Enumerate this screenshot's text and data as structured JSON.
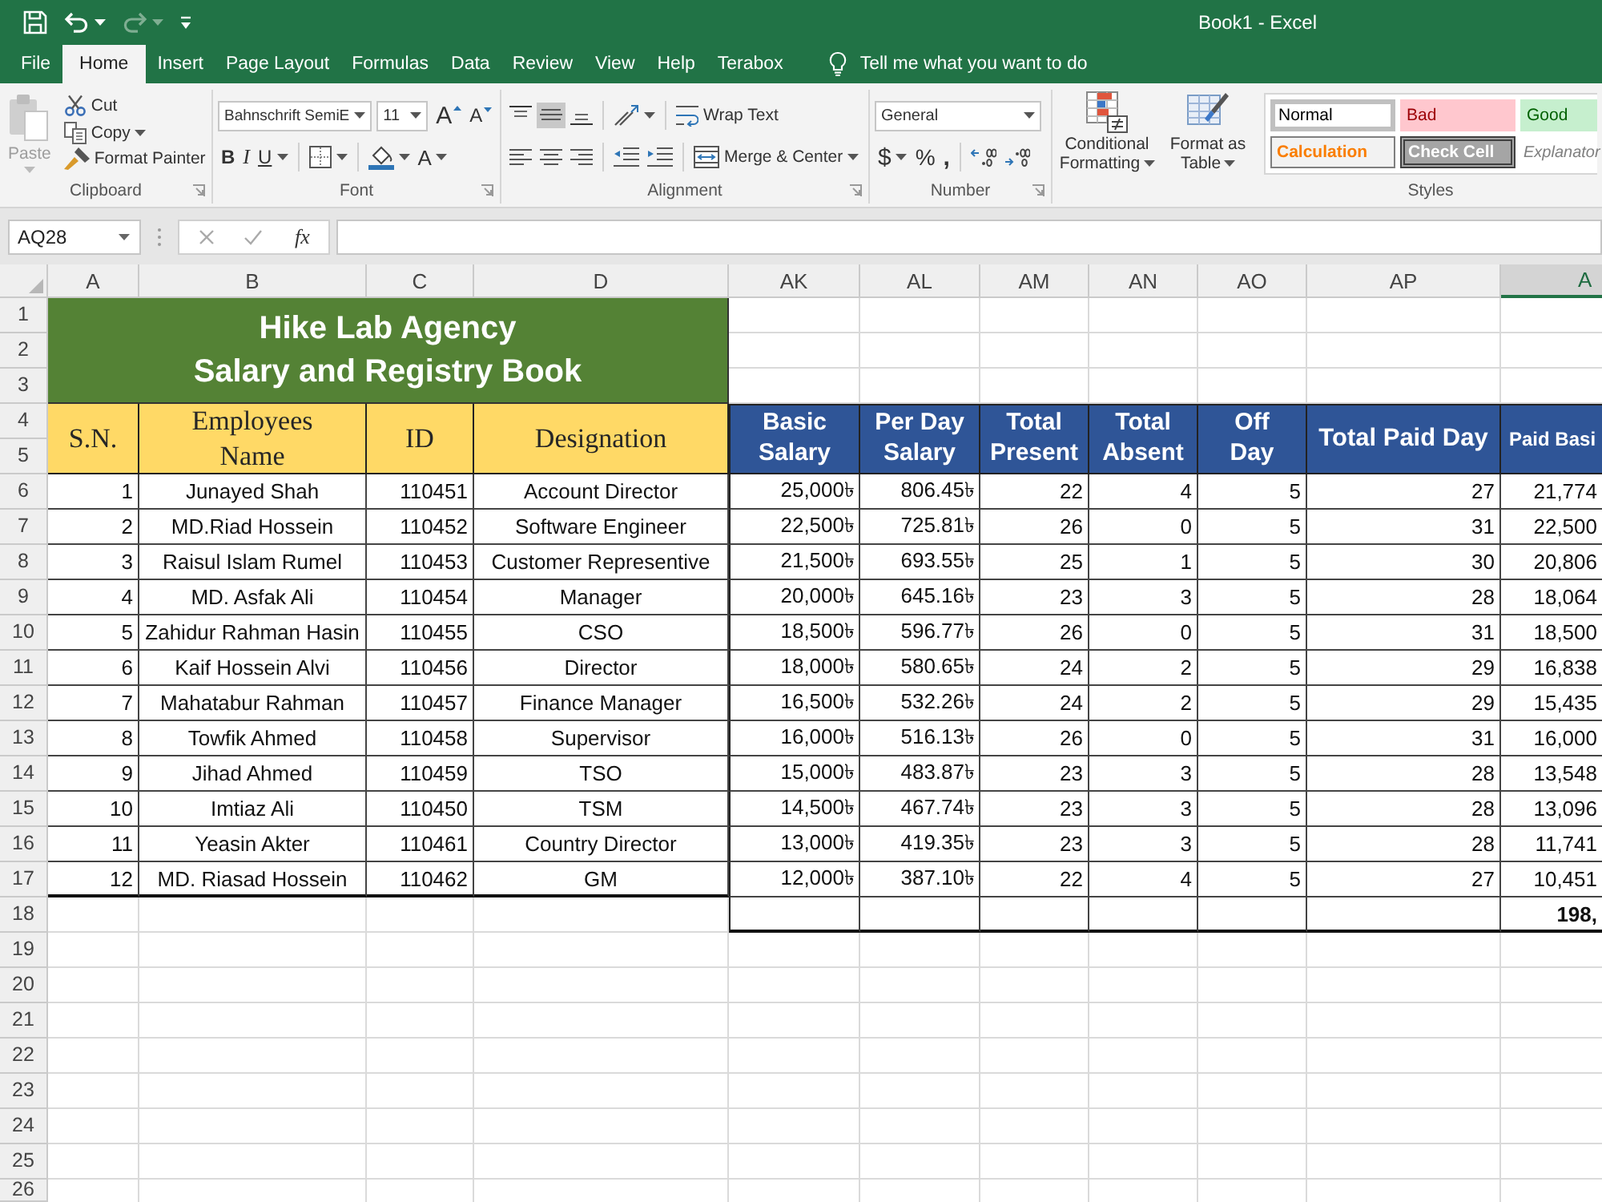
{
  "window": {
    "title": "Book1 - Excel"
  },
  "quick_access": {
    "redo": {
      "disabled": true
    }
  },
  "tabs": [
    {
      "label": "File",
      "selected": false
    },
    {
      "label": "Home",
      "selected": true
    },
    {
      "label": "Insert",
      "selected": false
    },
    {
      "label": "Page Layout",
      "selected": false
    },
    {
      "label": "Formulas",
      "selected": false
    },
    {
      "label": "Data",
      "selected": false
    },
    {
      "label": "Review",
      "selected": false
    },
    {
      "label": "View",
      "selected": false
    },
    {
      "label": "Help",
      "selected": false
    },
    {
      "label": "Terabox",
      "selected": false
    }
  ],
  "tell_me": {
    "label": "Tell me what you want to do"
  },
  "ribbon": {
    "clipboard": {
      "label": "Clipboard",
      "paste": {
        "label": "Paste",
        "disabled": true
      },
      "items": [
        {
          "kind": "cut",
          "label": "Cut"
        },
        {
          "kind": "copy",
          "label": "Copy"
        },
        {
          "kind": "format_painter",
          "label": "Format Painter"
        }
      ]
    },
    "font": {
      "label": "Font",
      "name": "Bahnschrift SemiE",
      "size": "11",
      "size_buttons": [
        {
          "kind": "grow",
          "label": "A"
        },
        {
          "kind": "shrink",
          "label": "A"
        }
      ],
      "tools": [
        {
          "kind": "bold",
          "label": "B"
        },
        {
          "kind": "italic",
          "label": "I"
        },
        {
          "kind": "underline",
          "label": "U"
        },
        {
          "kind": "borders"
        },
        {
          "kind": "fill_color"
        },
        {
          "kind": "font_color",
          "label": "A"
        }
      ]
    },
    "alignment": {
      "label": "Alignment",
      "vertical": [
        {
          "kind": "top",
          "selected": false
        },
        {
          "kind": "middle",
          "selected": true
        },
        {
          "kind": "bottom",
          "selected": false
        }
      ],
      "horizontal": [
        {
          "kind": "left",
          "selected": false
        },
        {
          "kind": "center",
          "selected": false
        },
        {
          "kind": "right",
          "selected": false
        }
      ],
      "wrap_text": {
        "label": "Wrap Text"
      },
      "merge": {
        "label": "Merge & Center"
      }
    },
    "number": {
      "label": "Number",
      "format": "General",
      "tools": [
        {
          "kind": "currency",
          "label": "$"
        },
        {
          "kind": "percent",
          "label": "%"
        },
        {
          "kind": "comma",
          "label": ","
        },
        {
          "kind": "increase_decimal"
        },
        {
          "kind": "decrease_decimal"
        }
      ]
    },
    "styles": {
      "label": "Styles",
      "commands": [
        {
          "kind": "conditional",
          "label": "Conditional Formatting"
        },
        {
          "kind": "table",
          "label": "Format as Table"
        }
      ],
      "cells": [
        {
          "kind": "normal",
          "label": "Normal",
          "selected": true
        },
        {
          "kind": "bad",
          "label": "Bad",
          "selected": false
        },
        {
          "kind": "good",
          "label": "Good",
          "selected": false
        },
        {
          "kind": "calculation",
          "label": "Calculation",
          "selected": false
        },
        {
          "kind": "check",
          "label": "Check Cell",
          "selected": false
        },
        {
          "kind": "explanatory",
          "label": "Explanator",
          "selected": false
        }
      ]
    }
  },
  "formula_bar": {
    "name_box": "AQ28",
    "function_label": "fx"
  },
  "sheet": {
    "columns": [
      {
        "label": "A",
        "selected": false
      },
      {
        "label": "B",
        "selected": false
      },
      {
        "label": "C",
        "selected": false
      },
      {
        "label": "D",
        "selected": false
      },
      {
        "label": "AK",
        "selected": false
      },
      {
        "label": "AL",
        "selected": false
      },
      {
        "label": "AM",
        "selected": false
      },
      {
        "label": "AN",
        "selected": false
      },
      {
        "label": "AO",
        "selected": false
      },
      {
        "label": "AP",
        "selected": false
      },
      {
        "label": "A",
        "selected": true
      }
    ],
    "rows": [
      "1",
      "2",
      "3",
      "4",
      "5",
      "6",
      "7",
      "8",
      "9",
      "10",
      "11",
      "12",
      "13",
      "14",
      "15",
      "16",
      "17",
      "18",
      "19",
      "20",
      "21",
      "22",
      "23",
      "24",
      "25",
      "26"
    ],
    "title": [
      "Hike Lab Agency",
      "Salary and Registry Book"
    ],
    "headers": [
      {
        "kind": "info",
        "label": "S.N."
      },
      {
        "kind": "info",
        "label": "Employees\nName"
      },
      {
        "kind": "info",
        "label": "ID"
      },
      {
        "kind": "info",
        "label": "Designation"
      },
      {
        "kind": "pay",
        "label": "Basic\nSalary"
      },
      {
        "kind": "pay",
        "label": "Per Day\nSalary"
      },
      {
        "kind": "pay",
        "label": "Total\nPresent"
      },
      {
        "kind": "pay",
        "label": "Total\nAbsent"
      },
      {
        "kind": "pay",
        "label": "Off\nDay"
      },
      {
        "kind": "pay",
        "label": "Total Paid Day"
      },
      {
        "kind": "pay",
        "label": "Paid Basi"
      }
    ],
    "records": [
      [
        "1",
        "Junayed Shah",
        "110451",
        "Account Director",
        "25,000৳",
        "806.45৳",
        "22",
        "4",
        "5",
        "27",
        "21,774"
      ],
      [
        "2",
        "MD.Riad Hossein",
        "110452",
        "Software Engineer",
        "22,500৳",
        "725.81৳",
        "26",
        "0",
        "5",
        "31",
        "22,500"
      ],
      [
        "3",
        "Raisul Islam Rumel",
        "110453",
        "Customer Representive",
        "21,500৳",
        "693.55৳",
        "25",
        "1",
        "5",
        "30",
        "20,806"
      ],
      [
        "4",
        "MD. Asfak Ali",
        "110454",
        "Manager",
        "20,000৳",
        "645.16৳",
        "23",
        "3",
        "5",
        "28",
        "18,064"
      ],
      [
        "5",
        "Zahidur Rahman Hasin",
        "110455",
        "CSO",
        "18,500৳",
        "596.77৳",
        "26",
        "0",
        "5",
        "31",
        "18,500"
      ],
      [
        "6",
        "Kaif Hossein Alvi",
        "110456",
        "Director",
        "18,000৳",
        "580.65৳",
        "24",
        "2",
        "5",
        "29",
        "16,838"
      ],
      [
        "7",
        "Mahatabur Rahman",
        "110457",
        "Finance Manager",
        "16,500৳",
        "532.26৳",
        "24",
        "2",
        "5",
        "29",
        "15,435"
      ],
      [
        "8",
        "Towfik Ahmed",
        "110458",
        "Supervisor",
        "16,000৳",
        "516.13৳",
        "26",
        "0",
        "5",
        "31",
        "16,000"
      ],
      [
        "9",
        "Jihad Ahmed",
        "110459",
        "TSO",
        "15,000৳",
        "483.87৳",
        "23",
        "3",
        "5",
        "28",
        "13,548"
      ],
      [
        "10",
        "Imtiaz Ali",
        "110450",
        "TSM",
        "14,500৳",
        "467.74৳",
        "23",
        "3",
        "5",
        "28",
        "13,096"
      ],
      [
        "11",
        "Yeasin Akter",
        "110461",
        "Country Director",
        "13,000৳",
        "419.35৳",
        "23",
        "3",
        "5",
        "28",
        "11,741"
      ],
      [
        "12",
        "MD. Riasad Hossein",
        "110462",
        "GM",
        "12,000৳",
        "387.10৳",
        "22",
        "4",
        "5",
        "27",
        "10,451"
      ]
    ],
    "totals": {
      "column_11": "198,"
    }
  }
}
